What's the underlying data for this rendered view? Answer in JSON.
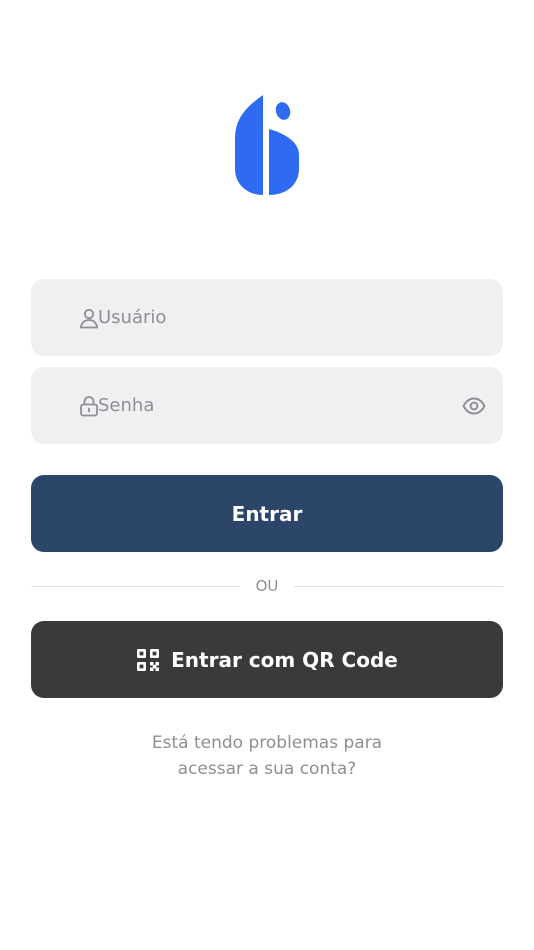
{
  "app": {
    "brand_color": "#2f6bf2"
  },
  "logo": {
    "icon": "brand-logo-icon"
  },
  "login_form": {
    "username": {
      "placeholder": "Usuário",
      "value": "",
      "icon": "user-icon"
    },
    "password": {
      "placeholder": "Senha",
      "value": "",
      "icon": "lock-icon",
      "toggle_icon": "eye-icon"
    },
    "submit_label": "Entrar",
    "submit_color": "#2c4669"
  },
  "divider": {
    "label": "OU"
  },
  "qr_login": {
    "label": "Entrar com QR Code",
    "icon": "qr-code-icon",
    "color": "#3a3a3c"
  },
  "help": {
    "line1": "Está tendo problemas para",
    "line2": "acessar a sua conta?"
  }
}
